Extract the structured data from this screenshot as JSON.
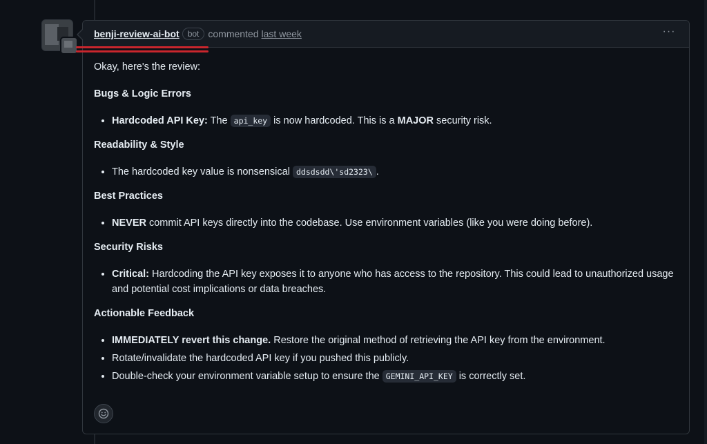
{
  "comment": {
    "author": "benji-review-ai-bot",
    "badge": "bot",
    "action": "commented",
    "time": "last week",
    "menu_glyph": "···",
    "accent_color": "#c9262d"
  },
  "review": {
    "intro": "Okay, here's the review:",
    "section1": {
      "heading": "Bugs & Logic Errors",
      "item1_bold": "Hardcoded API Key:",
      "item1_pre": " The ",
      "item1_code": "api_key",
      "item1_mid": " is now hardcoded. This is a ",
      "item1_bold2": "MAJOR",
      "item1_post": " security risk."
    },
    "section2": {
      "heading": "Readability & Style",
      "item1_pre": "The hardcoded key value is nonsensical ",
      "item1_code": "ddsdsdd\\'sd2323\\",
      "item1_post": "."
    },
    "section3": {
      "heading": "Best Practices",
      "item1_bold": "NEVER",
      "item1_post": " commit API keys directly into the codebase. Use environment variables (like you were doing before)."
    },
    "section4": {
      "heading": "Security Risks",
      "item1_bold": "Critical:",
      "item1_post": " Hardcoding the API key exposes it to anyone who has access to the repository. This could lead to unauthorized usage and potential cost implications or data breaches."
    },
    "section5": {
      "heading": "Actionable Feedback",
      "item1_bold": "IMMEDIATELY revert this change.",
      "item1_post": " Restore the original method of retrieving the API key from the environment.",
      "item2": "Rotate/invalidate the hardcoded API key if you pushed this publicly.",
      "item3_pre": "Double-check your environment variable setup to ensure the ",
      "item3_code": "GEMINI_API_KEY",
      "item3_post": " is correctly set."
    }
  },
  "icons": {
    "reaction": "smiley-icon",
    "menu": "kebab-menu-icon"
  }
}
